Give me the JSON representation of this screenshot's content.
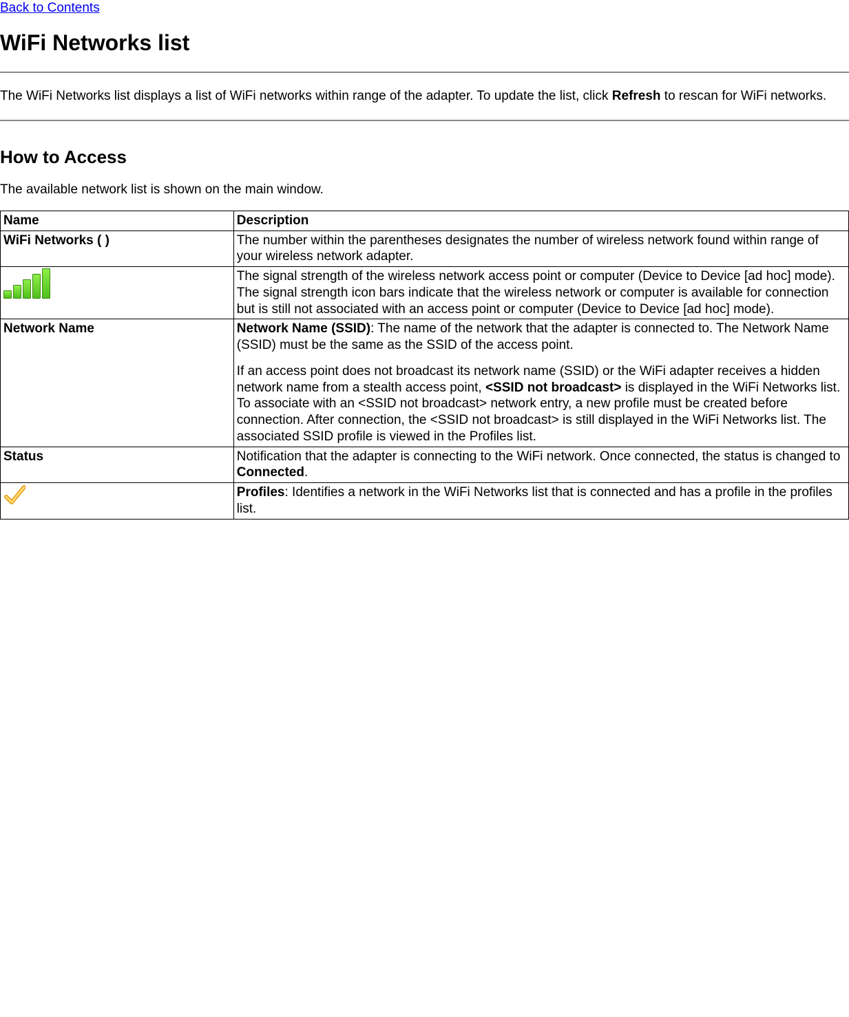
{
  "nav": {
    "back_link": "Back to Contents"
  },
  "title": "WiFi Networks list",
  "intro": {
    "pre": "The WiFi Networks list displays a list of WiFi networks within range of the adapter. To update the list, click ",
    "bold": "Refresh",
    "post": " to rescan for WiFi networks."
  },
  "section_heading": "How to Access",
  "section_intro": "The available network list is shown on the main window.",
  "table": {
    "headers": [
      "Name",
      "Description"
    ],
    "rows": [
      {
        "name_type": "text_bold",
        "name": "WiFi Networks ( )",
        "desc_type": "plain",
        "desc": "The number within the parentheses designates the number of wireless network found within range of your wireless network adapter."
      },
      {
        "name_type": "signal_icon",
        "name": "signal-strength-icon",
        "desc_type": "plain",
        "desc": "The signal strength of the wireless network access point or computer (Device to Device [ad hoc] mode). The signal strength icon bars indicate that the wireless network or computer is available for connection but is still not associated with an access point or computer (Device to Device [ad hoc] mode)."
      },
      {
        "name_type": "text_bold",
        "name": "Network Name",
        "desc_type": "network_name",
        "desc_bold1": "Network Name (SSID)",
        "desc_p1_rest": ": The name of the network that the adapter is connected to. The Network Name (SSID) must be the same as the SSID of the access point.",
        "desc_p2_pre": "If an access point does not broadcast its network name (SSID) or the WiFi adapter receives a hidden network name from a stealth access point, ",
        "desc_p2_bold": "<SSID not broadcast>",
        "desc_p2_post": " is displayed in the WiFi Networks list. To associate with an <SSID not broadcast> network entry, a new profile must be created before connection. After connection, the <SSID not broadcast> is still displayed in the WiFi Networks list. The associated SSID profile is viewed in the Profiles list."
      },
      {
        "name_type": "text_bold",
        "name": "Status",
        "desc_type": "status",
        "desc_pre": "Notification that the adapter is connecting to the WiFi network. Once connected, the status is changed to ",
        "desc_bold": "Connected",
        "desc_post": "."
      },
      {
        "name_type": "check_icon",
        "name": "profile-check-icon",
        "desc_type": "profiles",
        "desc_bold": "Profiles",
        "desc_rest": ": Identifies a network in the WiFi Networks list that is connected and has a profile in the profiles list."
      }
    ]
  }
}
